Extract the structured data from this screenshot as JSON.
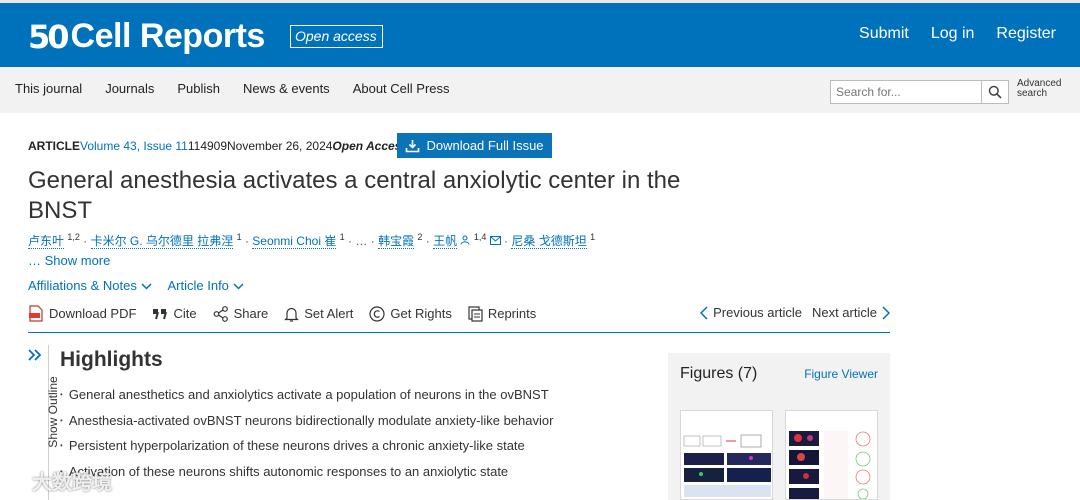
{
  "header": {
    "logo_mark": "50",
    "logo_text": "Cell Reports",
    "open_access": "Open access",
    "links": [
      "Submit",
      "Log in",
      "Register"
    ]
  },
  "nav": {
    "items": [
      "This journal",
      "Journals",
      "Publish",
      "News & events",
      "About Cell Press"
    ],
    "search_placeholder": "Search for...",
    "advanced_search_line1": "Advanced",
    "advanced_search_line2": "search"
  },
  "article": {
    "type": "ARTICLE",
    "volume": "Volume 43, Issue 11",
    "number": "114909",
    "date": "November 26, 2024",
    "access": "Open Access",
    "download_issue": "Download Full Issue",
    "title": "General anesthesia activates a central anxiolytic center in the BNST",
    "authors": [
      {
        "name": "卢东叶",
        "sup": "1,2"
      },
      {
        "name": "卡米尔 G. 乌尔德里 拉弗涅",
        "sup": "1"
      },
      {
        "name": "Seonmi Choi 崔",
        "sup": "1"
      },
      {
        "name": "韩宝霞",
        "sup": "2"
      },
      {
        "name": "王帆",
        "sup": "1,4"
      },
      {
        "name": "尼桑 戈德斯坦",
        "sup": "1"
      }
    ],
    "ellipsis": "…",
    "show_more": "… Show more",
    "affiliations": "Affiliations & Notes",
    "article_info": "Article Info"
  },
  "toolbar": {
    "download_pdf": "Download PDF",
    "cite": "Cite",
    "share": "Share",
    "set_alert": "Set Alert",
    "get_rights": "Get Rights",
    "reprints": "Reprints",
    "previous": "Previous article",
    "next": "Next article"
  },
  "outline": {
    "label": "Show Outline"
  },
  "highlights": {
    "title": "Highlights",
    "items": [
      "General anesthetics and anxiolytics activate a population of neurons in the ovBNST",
      "Anesthesia-activated ovBNST neurons bidirectionally modulate anxiety-like behavior",
      "Persistent hyperpolarization of these neurons drives a chronic anxiety-like state",
      "Activation of these neurons shifts autonomic responses to an anxiolytic state"
    ]
  },
  "figures": {
    "title": "Figures (7)",
    "viewer": "Figure Viewer"
  },
  "watermark": "大数跨境",
  "colors": {
    "brand_blue": "#0072bc",
    "nav_bg": "#f2f2f2",
    "panel_bg": "#f2f2f2"
  }
}
